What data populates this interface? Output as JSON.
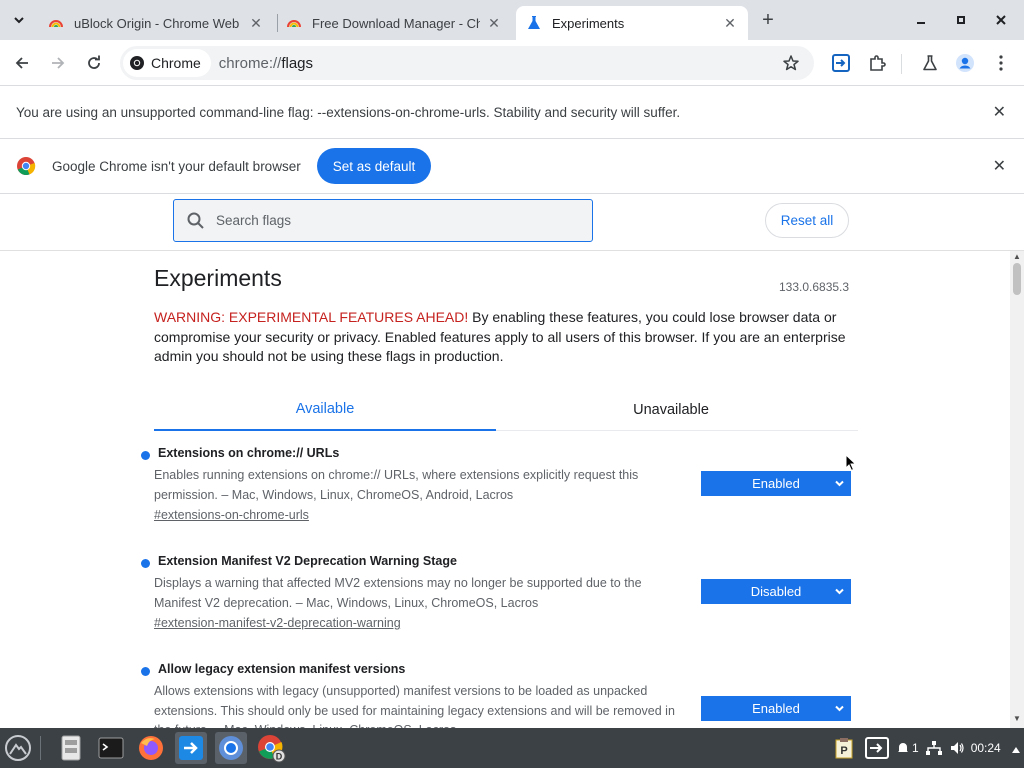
{
  "tabs": [
    {
      "title": "uBlock Origin - Chrome Web",
      "active": false
    },
    {
      "title": "Free Download Manager - Ch",
      "active": false
    },
    {
      "title": "Experiments",
      "active": true
    }
  ],
  "toolbar": {
    "chip_label": "Chrome",
    "url_scheme": "chrome://",
    "url_host": "flags"
  },
  "infobars": {
    "flag_warning": "You are using an unsupported command-line flag: --extensions-on-chrome-urls. Stability and security will suffer.",
    "default_browser": "Google Chrome isn't your default browser",
    "set_default_label": "Set as default"
  },
  "flags_header": {
    "search_placeholder": "Search flags",
    "reset_label": "Reset all"
  },
  "page": {
    "title": "Experiments",
    "version": "133.0.6835.3",
    "warning_prefix": "WARNING: EXPERIMENTAL FEATURES AHEAD!",
    "warning_text": " By enabling these features, you could lose browser data or compromise your security or privacy. Enabled features apply to all users of this browser. If you are an enterprise admin you should not be using these flags in production.",
    "tab_available": "Available",
    "tab_unavailable": "Unavailable"
  },
  "flags": [
    {
      "name": "Extensions on chrome:// URLs",
      "description": "Enables running extensions on chrome:// URLs, where extensions explicitly request this permission. – Mac, Windows, Linux, ChromeOS, Android, Lacros",
      "link": "#extensions-on-chrome-urls",
      "value": "Enabled"
    },
    {
      "name": "Extension Manifest V2 Deprecation Warning Stage",
      "description": "Displays a warning that affected MV2 extensions may no longer be supported due to the Manifest V2 deprecation. – Mac, Windows, Linux, ChromeOS, Lacros",
      "link": "#extension-manifest-v2-deprecation-warning",
      "value": "Disabled"
    },
    {
      "name": "Allow legacy extension manifest versions",
      "description": "Allows extensions with legacy (unsupported) manifest versions to be loaded as unpacked extensions. This should only be used for maintaining legacy extensions and will be removed in the future. – Mac, Windows, Linux, ChromeOS, Lacros",
      "value": "Enabled"
    }
  ],
  "taskbar": {
    "clock": "00:24",
    "notification_count": "1",
    "icons": [
      "start-menu-icon",
      "file-manager-icon",
      "terminal-icon",
      "firefox-icon",
      "download-manager-icon",
      "chromium-icon",
      "chrome-dev-icon"
    ]
  },
  "colors": {
    "accent": "#1a73e8",
    "warning_red": "#c5221f",
    "taskbar": "#3c4146",
    "tabstrip": "#dee1e6"
  }
}
